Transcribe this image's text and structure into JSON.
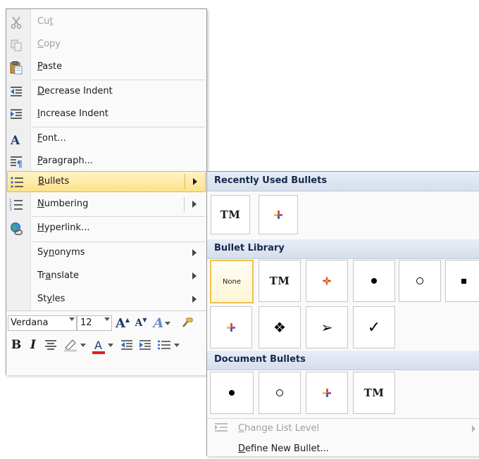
{
  "menu": {
    "items": [
      {
        "pre": "Cu",
        "acc": "t",
        "post": "",
        "disabled": true
      },
      {
        "pre": "",
        "acc": "C",
        "post": "opy",
        "disabled": true
      },
      {
        "pre": "",
        "acc": "P",
        "post": "aste"
      },
      {
        "pre": "",
        "acc": "D",
        "post": "ecrease Indent"
      },
      {
        "pre": "",
        "acc": "I",
        "post": "ncrease Indent"
      },
      {
        "pre": "",
        "acc": "F",
        "post": "ont..."
      },
      {
        "pre": "",
        "acc": "P",
        "post": "aragraph..."
      },
      {
        "pre": "",
        "acc": "B",
        "post": "ullets"
      },
      {
        "pre": "",
        "acc": "N",
        "post": "umbering"
      },
      {
        "pre": "",
        "acc": "H",
        "post": "yperlink..."
      },
      {
        "pre": "Sy",
        "acc": "n",
        "post": "onyms"
      },
      {
        "pre": "Tr",
        "acc": "a",
        "post": "nslate"
      },
      {
        "pre": "St",
        "acc": "y",
        "post": "les"
      }
    ]
  },
  "mini_toolbar": {
    "font": "Verdana",
    "size": "12",
    "grow_font": "A",
    "shrink_font": "A",
    "styles": "A",
    "bold": "B",
    "italic": "I",
    "font_color": "A"
  },
  "submenu": {
    "recent_title": "Recently Used Bullets",
    "library_title": "Bullet Library",
    "document_title": "Document Bullets",
    "recent_tm": "TM",
    "none_label": "None",
    "library_tm": "TM",
    "library_check": "✓",
    "library_diamonds": "❖",
    "library_arrow": "➢",
    "document_tm": "TM",
    "change_level": {
      "pre": "",
      "acc": "C",
      "post": "hange List Level",
      "disabled": true
    },
    "define_new": {
      "pre": "",
      "acc": "D",
      "post": "efine New Bullet..."
    }
  },
  "colors": {
    "highlight": "#fde28a",
    "section_header": "#d5deeb",
    "font_color_bar": "#e31d1d"
  }
}
